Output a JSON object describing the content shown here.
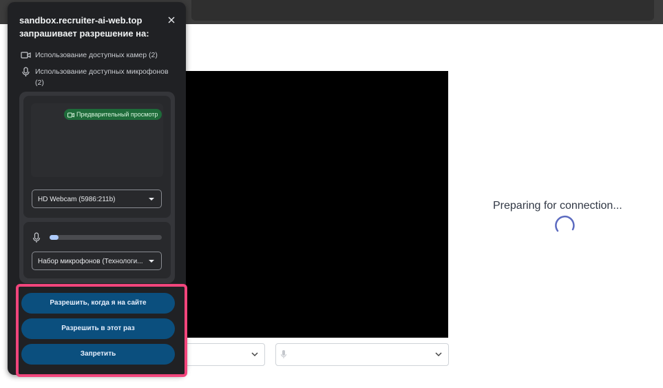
{
  "page": {
    "status_text": "Preparing for connection...",
    "colors": {
      "accent": "#5c6bc0",
      "popup_bg": "#202124",
      "button": "#0b4f7e",
      "highlight": "#f1457c",
      "badge": "#1e6b3a"
    }
  },
  "selects": {
    "camera": {
      "value": "",
      "icon": "chevron-down-icon"
    },
    "microphone": {
      "value": "",
      "icon": "microphone-icon"
    }
  },
  "popup": {
    "origin": "sandbox.recruiter-ai-web.top",
    "subtitle": "запрашивает разрешение на:",
    "close_icon": "close-icon",
    "permissions": [
      {
        "icon": "camera-icon",
        "label": "Использование доступных камер (2)"
      },
      {
        "icon": "microphone-icon",
        "label": "Использование доступных микрофонов (2)"
      }
    ],
    "preview_badge": "Предварительный просмотр",
    "camera_device": "HD Webcam (5986:211b)",
    "microphone_device": "Набор микрофонов (Технологи...",
    "mic_level": 0.08,
    "buttons": {
      "allow_on_site": "Разрешить, когда я на сайте",
      "allow_once": "Разрешить в этот раз",
      "deny": "Запретить"
    }
  }
}
